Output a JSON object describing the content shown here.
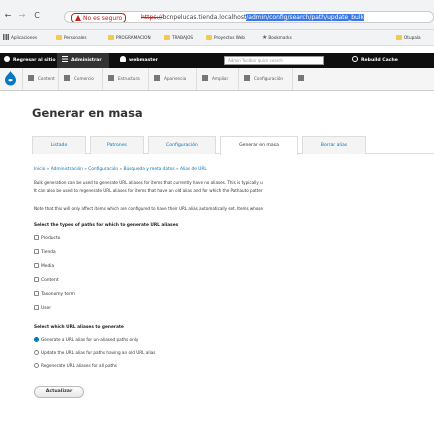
{
  "browser": {
    "back": "←",
    "forward": "→",
    "reload": "C",
    "security_label": "No es seguro",
    "url_proto": "https://",
    "url_host": "bcnpelucas.tienda.localhost",
    "url_path": "/admin/config/search/path/update_bulk",
    "bookmarks": [
      "Aplicaciones",
      "Personales",
      "PROGRAMACION",
      "TRABAJOS",
      "Proyectos Web",
      "Bookmarks",
      "Otupala"
    ]
  },
  "toolbar": {
    "back_label": "Regresar al sitio",
    "manage_label": "Administrar",
    "user_label": "webmaster",
    "search_placeholder": "Admin Toolbar quick search",
    "cache_label": "Rebuild Cache"
  },
  "subtoolbar": [
    "Content",
    "Comercio",
    "Estructura",
    "Apariencia",
    "Ampliar",
    "Configuración"
  ],
  "page": {
    "title": "Generar en masa",
    "tabs": [
      "Listado",
      "Patrones",
      "Configuración",
      "Generar en masa",
      "Borrar alias"
    ],
    "breadcrumb": [
      "Inicio",
      "Administración",
      "Configuración",
      "Búsqueda y meta datos",
      "Alias de URL"
    ],
    "breadcrumb_sep": "»",
    "desc1": "Bulk generation can be used to generate URL aliases for items that currently have no aliases. This is typically u",
    "desc2": "It can also be used to regenerate URL aliases for items that have an old alias and for which the Pathauto patter",
    "note": "Note that this will only affect items which are configured to have their URL alias automatically set. Items whose",
    "types_label": "Select the types of paths for which to generate URL aliases",
    "types": [
      "Producto",
      "Tienda",
      "Media",
      "Content",
      "Taxonomy term",
      "User"
    ],
    "which_label": "Select which URL aliases to generate",
    "options": [
      {
        "label": "Generate a URL alias for un-aliased paths only",
        "checked": true
      },
      {
        "label": "Update the URL alias for paths having an old URL alias",
        "checked": false
      },
      {
        "label": "Regenerate URL aliases for all paths",
        "checked": false
      }
    ],
    "submit": "Actualizar"
  }
}
